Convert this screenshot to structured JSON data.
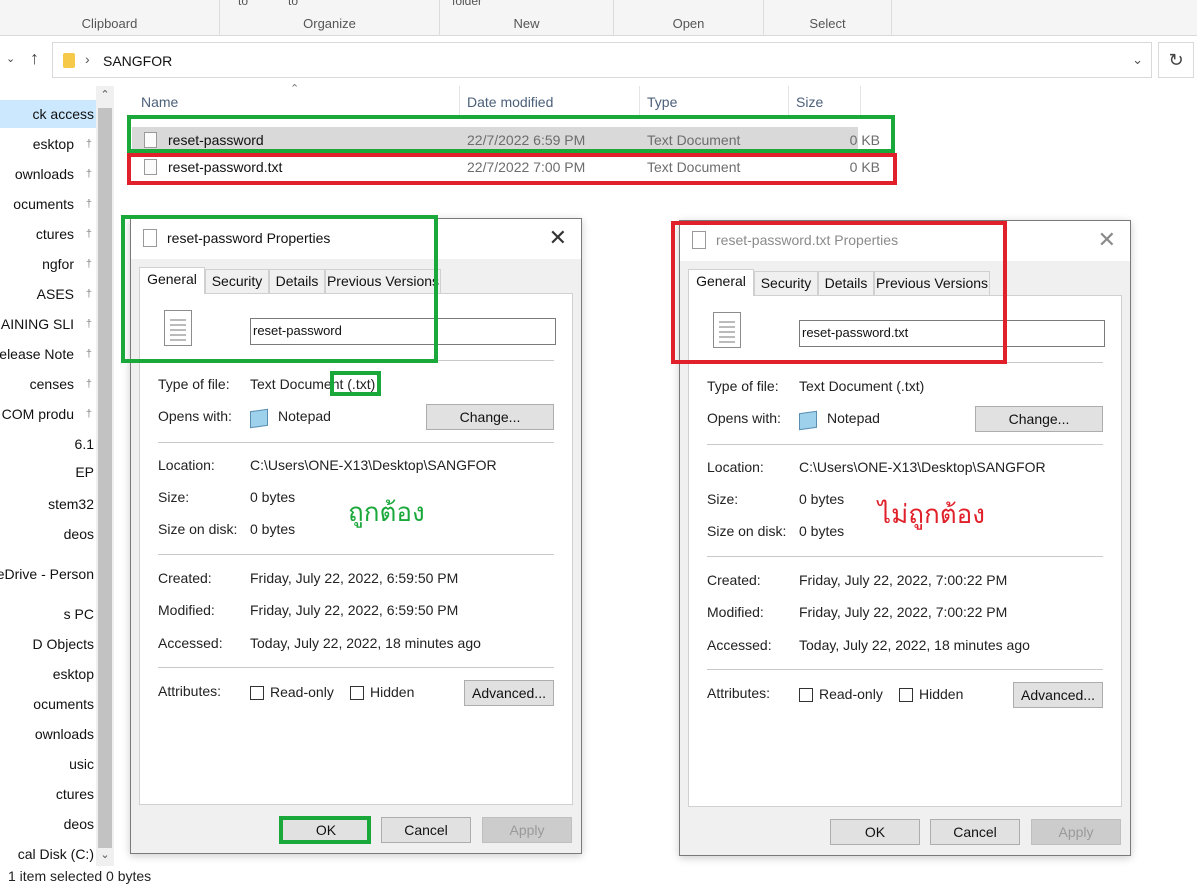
{
  "ribbon": {
    "groups": [
      "Clipboard",
      "Organize",
      "New",
      "Open",
      "Select"
    ],
    "cut_labels": [
      "to",
      "to",
      "folder"
    ]
  },
  "address": {
    "crumb": "SANGFOR"
  },
  "nav_pane": {
    "items": [
      {
        "label": "ck access",
        "selected": true,
        "pin": false
      },
      {
        "label": "esktop",
        "pin": true
      },
      {
        "label": "ownloads",
        "pin": true
      },
      {
        "label": "ocuments",
        "pin": true
      },
      {
        "label": "ctures",
        "pin": true
      },
      {
        "label": "ngfor",
        "pin": true
      },
      {
        "label": "ASES",
        "pin": true
      },
      {
        "label": "RAINING SLI",
        "pin": true
      },
      {
        "label": "elease Note",
        "pin": true
      },
      {
        "label": "censes",
        "pin": true
      },
      {
        "label": "COM produ",
        "pin": true
      },
      {
        "label": "6.1",
        "pin": false
      },
      {
        "label": "EP",
        "pin": false
      },
      {
        "label": "stem32",
        "pin": false
      },
      {
        "label": "deos",
        "pin": false
      },
      {
        "label": "eDrive - Person",
        "pin": false
      },
      {
        "label": "s PC",
        "pin": false
      },
      {
        "label": "D Objects",
        "pin": false
      },
      {
        "label": "esktop",
        "pin": false
      },
      {
        "label": "ocuments",
        "pin": false
      },
      {
        "label": "ownloads",
        "pin": false
      },
      {
        "label": "usic",
        "pin": false
      },
      {
        "label": "ctures",
        "pin": false
      },
      {
        "label": "deos",
        "pin": false
      },
      {
        "label": "cal Disk (C:)",
        "pin": false
      }
    ]
  },
  "status_bar": "1 item selected  0 bytes",
  "file_list": {
    "columns": [
      "Name",
      "Date modified",
      "Type",
      "Size"
    ],
    "rows": [
      {
        "name": "reset-password",
        "date": "22/7/2022 6:59 PM",
        "type": "Text Document",
        "size": "0 KB",
        "selected": true
      },
      {
        "name": "reset-password.txt",
        "date": "22/7/2022 7:00 PM",
        "type": "Text Document",
        "size": "0 KB",
        "selected": false
      }
    ]
  },
  "dialog_left": {
    "title": "reset-password Properties",
    "tabs": [
      "General",
      "Security",
      "Details",
      "Previous Versions"
    ],
    "file_name": "reset-password",
    "type_label": "Type of file:",
    "type_value_main": "Text Document",
    "type_value_ext": "(.txt)",
    "opens_label": "Opens with:",
    "opens_value": "Notepad",
    "change_btn": "Change...",
    "location_label": "Location:",
    "location_value": "C:\\Users\\ONE-X13\\Desktop\\SANGFOR",
    "size_label": "Size:",
    "size_value": "0 bytes",
    "size_disk_label": "Size on disk:",
    "size_disk_value": "0 bytes",
    "created_label": "Created:",
    "created_value": "Friday, July 22, 2022, 6:59:50 PM",
    "modified_label": "Modified:",
    "modified_value": "Friday, July 22, 2022, 6:59:50 PM",
    "accessed_label": "Accessed:",
    "accessed_value": "Today, July 22, 2022, 18 minutes ago",
    "attributes_label": "Attributes:",
    "readonly_label": "Read-only",
    "hidden_label": "Hidden",
    "advanced_btn": "Advanced...",
    "ok_btn": "OK",
    "cancel_btn": "Cancel",
    "apply_btn": "Apply"
  },
  "dialog_right": {
    "title": "reset-password.txt Properties",
    "tabs": [
      "General",
      "Security",
      "Details",
      "Previous Versions"
    ],
    "file_name": "reset-password.txt",
    "type_label": "Type of file:",
    "type_value": "Text Document (.txt)",
    "opens_label": "Opens with:",
    "opens_value": "Notepad",
    "change_btn": "Change...",
    "location_label": "Location:",
    "location_value": "C:\\Users\\ONE-X13\\Desktop\\SANGFOR",
    "size_label": "Size:",
    "size_value": "0 bytes",
    "size_disk_label": "Size on disk:",
    "size_disk_value": "0 bytes",
    "created_label": "Created:",
    "created_value": "Friday, July 22, 2022, 7:00:22 PM",
    "modified_label": "Modified:",
    "modified_value": "Friday, July 22, 2022, 7:00:22 PM",
    "accessed_label": "Accessed:",
    "accessed_value": "Today, July 22, 2022, 18 minutes ago",
    "attributes_label": "Attributes:",
    "readonly_label": "Read-only",
    "hidden_label": "Hidden",
    "advanced_btn": "Advanced...",
    "ok_btn": "OK",
    "cancel_btn": "Cancel",
    "apply_btn": "Apply"
  },
  "annotations": {
    "correct": "ถูกต้อง",
    "incorrect": "ไม่ถูกต้อง",
    "correct_color": "#1aa83b",
    "incorrect_color": "#e0202a"
  }
}
